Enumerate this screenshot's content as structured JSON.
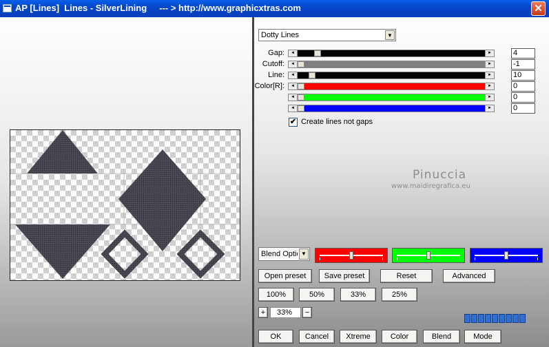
{
  "window": {
    "title": "AP [Lines]  Lines - SilverLining     --- > http://www.graphicxtras.com",
    "close_glyph": "✕"
  },
  "preset_dropdown": {
    "value": "Dotty Lines"
  },
  "params": [
    {
      "label": "Gap:",
      "value": "4",
      "fill": "#000000",
      "thumb_fraction": 0.09
    },
    {
      "label": "Cutoff:",
      "value": "-1",
      "fill": "#808080",
      "thumb_fraction": 0.0
    },
    {
      "label": "Line:",
      "value": "10",
      "fill": "#000000",
      "thumb_fraction": 0.06
    },
    {
      "label": "Color[R]:",
      "value": "0",
      "fill": "#ff0000",
      "thumb_fraction": 0.0
    },
    {
      "label": "",
      "value": "0",
      "fill": "#00ff00",
      "thumb_fraction": 0.0
    },
    {
      "label": "",
      "value": "0",
      "fill": "#0000ff",
      "thumb_fraction": 0.0
    }
  ],
  "checkbox": {
    "label": "Create lines not gaps",
    "checked": true,
    "glyph": "✔"
  },
  "watermark": {
    "name": "Pinuccia",
    "url": "www.maidiregrafica.eu"
  },
  "blend_dropdown": {
    "value": "Blend Optio"
  },
  "blend_colors": [
    {
      "color": "#ff0000",
      "level": 0.5
    },
    {
      "color": "#00ff00",
      "level": 0.5
    },
    {
      "color": "#0000ff",
      "level": 0.5
    }
  ],
  "buttons": {
    "open_preset": "Open preset",
    "save_preset": "Save preset",
    "reset": "Reset",
    "advanced": "Advanced",
    "zoom_100": "100%",
    "zoom_50": "50%",
    "zoom_33": "33%",
    "zoom_25": "25%",
    "zoom_in": "+",
    "zoom_out": "−",
    "ok": "OK",
    "cancel": "Cancel",
    "xtreme": "Xtreme",
    "color": "Color",
    "blend": "Blend",
    "mode": "Mode"
  },
  "zoom_value": "33%",
  "progress": {
    "segments": 9,
    "filled": 9
  }
}
